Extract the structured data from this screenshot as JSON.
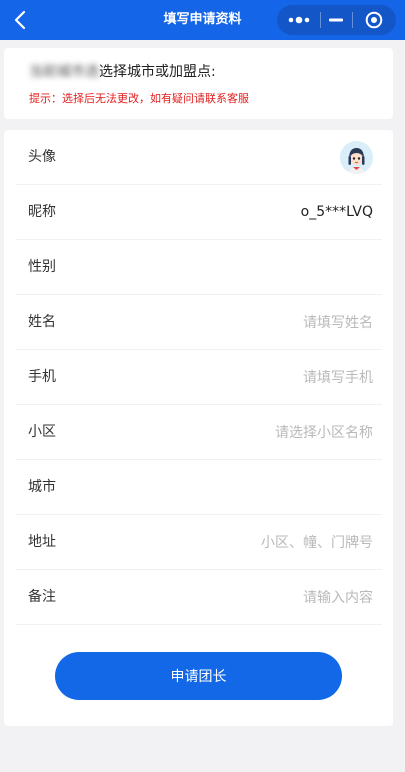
{
  "nav": {
    "title": "填写申请资料",
    "icons": [
      "back-chevron-icon",
      "more-dots-icon",
      "minimize-icon",
      "close-target-icon"
    ]
  },
  "notice": {
    "blurred_prefix": "当前城市选",
    "visible_text": "选择城市或加盟点:",
    "tip": "提示：选择后无法更改，如有疑问请联系客服"
  },
  "form": {
    "avatar_label": "头像",
    "nickname_label": "昵称",
    "nickname_value": "o_5***LVQ",
    "gender_label": "性别",
    "gender_value": "",
    "name_label": "姓名",
    "name_placeholder": "请填写姓名",
    "phone_label": "手机",
    "phone_placeholder": "请填写手机",
    "community_label": "小区",
    "community_placeholder": "请选择小区名称",
    "city_label": "城市",
    "city_value": "",
    "address_label": "地址",
    "address_placeholder": "小区、幢、门牌号",
    "remark_label": "备注",
    "remark_placeholder": "请输入内容",
    "submit_label": "申请团长"
  },
  "colors": {
    "primary": "#1268e6",
    "nav_bg": "#1565e8",
    "warning": "#e31e1e",
    "page_bg": "#f2f2f4"
  }
}
